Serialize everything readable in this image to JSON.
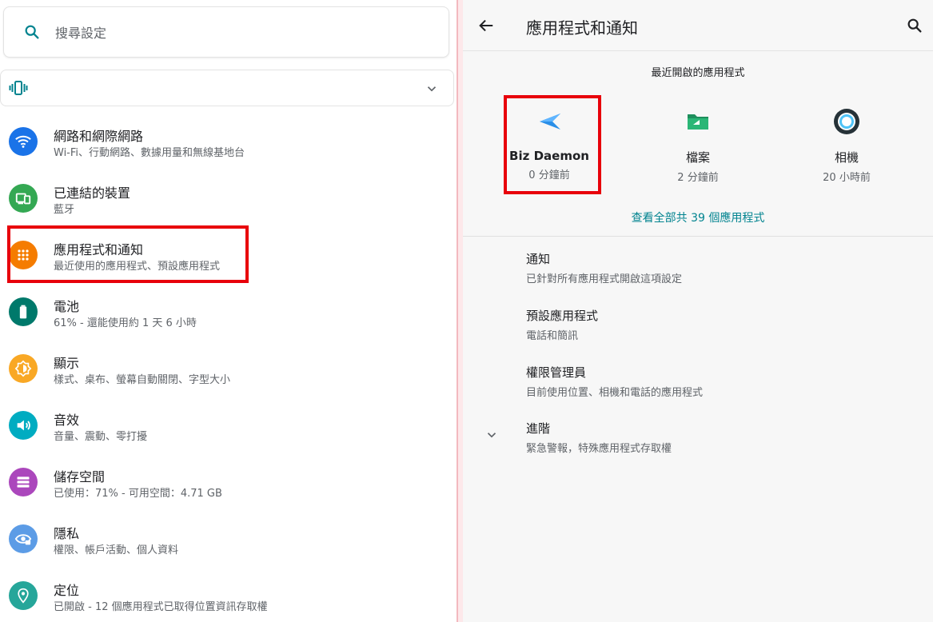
{
  "search": {
    "placeholder": "搜尋設定",
    "icon": "search-icon"
  },
  "settings_items": [
    {
      "title": "網路和網際網路",
      "subtitle": "Wi-Fi、行動網路、數據用量和無線基地台",
      "icon": "wifi-icon",
      "color": "#1a73e8"
    },
    {
      "title": "已連結的裝置",
      "subtitle": "藍牙",
      "icon": "devices-icon",
      "color": "#34a853"
    },
    {
      "title": "應用程式和通知",
      "subtitle": "最近使用的應用程式、預設應用程式",
      "icon": "apps-icon",
      "color": "#f57c00"
    },
    {
      "title": "電池",
      "subtitle": "61% - 還能使用約 1 天 6 小時",
      "icon": "battery-icon",
      "color": "#00796b"
    },
    {
      "title": "顯示",
      "subtitle": "樣式、桌布、螢幕自動關閉、字型大小",
      "icon": "display-icon",
      "color": "#f9a825"
    },
    {
      "title": "音效",
      "subtitle": "音量、震動、零打擾",
      "icon": "sound-icon",
      "color": "#00acc1"
    },
    {
      "title": "儲存空間",
      "subtitle": "已使用：71% - 可用空間：4.71 GB",
      "icon": "storage-icon",
      "color": "#ab47bc"
    },
    {
      "title": "隱私",
      "subtitle": "權限、帳戶活動、個人資料",
      "icon": "privacy-icon",
      "color": "#5c9ce6"
    },
    {
      "title": "定位",
      "subtitle": "已開啟 - 12 個應用程式已取得位置資訊存取權",
      "icon": "location-icon",
      "color": "#26a69a"
    }
  ],
  "header": {
    "title": "應用程式和通知"
  },
  "recent": {
    "title": "最近開啟的應用程式",
    "apps": [
      {
        "name": "Biz Daemon",
        "time": "0 分鐘前",
        "icon": "biz-daemon-icon"
      },
      {
        "name": "檔案",
        "time": "2 分鐘前",
        "icon": "files-icon"
      },
      {
        "name": "相機",
        "time": "20 小時前",
        "icon": "camera-icon"
      }
    ],
    "see_all": "查看全部共 39 個應用程式"
  },
  "right_items": [
    {
      "title": "通知",
      "subtitle": "已針對所有應用程式開啟這項設定"
    },
    {
      "title": "預設應用程式",
      "subtitle": "電話和簡訊"
    },
    {
      "title": "權限管理員",
      "subtitle": "目前使用位置、相機和電話的應用程式"
    },
    {
      "title": "進階",
      "subtitle": "緊急警報，特殊應用程式存取權"
    }
  ],
  "colors": {
    "accent": "#00838f",
    "highlight": "#e8000b"
  }
}
